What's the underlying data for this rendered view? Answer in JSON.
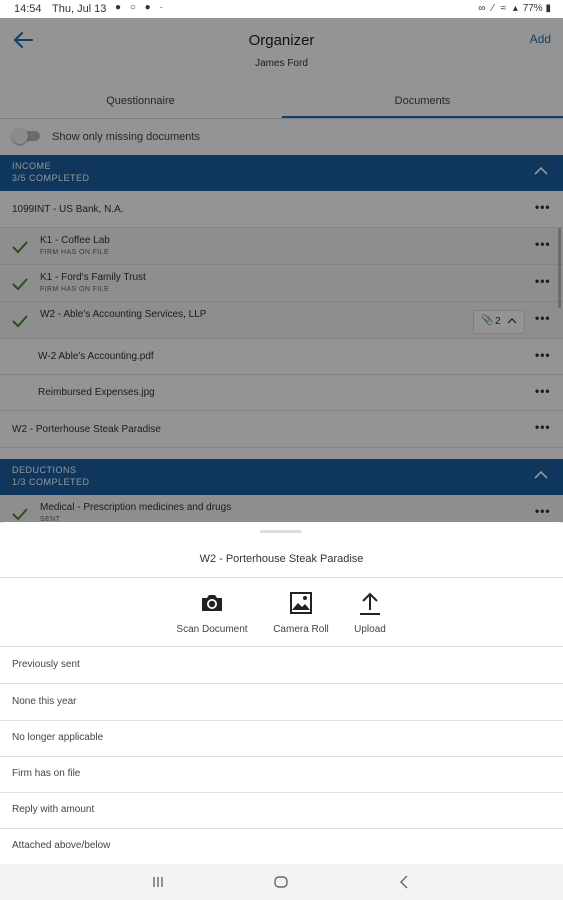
{
  "status_bar": {
    "time": "14:54",
    "date": "Thu, Jul 13",
    "battery": "77%"
  },
  "header": {
    "title": "Organizer",
    "subtitle": "James Ford",
    "add_label": "Add"
  },
  "tabs": [
    {
      "label": "Questionnaire",
      "active": false
    },
    {
      "label": "Documents",
      "active": true
    }
  ],
  "filter": {
    "toggle_label": "Show only missing documents",
    "enabled": false
  },
  "sections": [
    {
      "title": "INCOME",
      "progress": "3/5 COMPLETED",
      "items": [
        {
          "label": "1099INT - US Bank, N.A.",
          "checked": false
        },
        {
          "label": "K1 - Coffee Lab",
          "sublabel": "FIRM HAS ON FILE",
          "checked": true
        },
        {
          "label": "K1 - Ford's Family Trust",
          "sublabel": "FIRM HAS ON FILE",
          "checked": true
        },
        {
          "label": "W2 - Able's Accounting Services, LLP",
          "checked": true,
          "attachments": "2"
        },
        {
          "label": "W-2 Able's Accounting.pdf"
        },
        {
          "label": "Reimbursed Expenses.jpg"
        },
        {
          "label": "W2 - Porterhouse Steak Paradise",
          "checked": false
        }
      ]
    },
    {
      "title": "DEDUCTIONS",
      "progress": "1/3 COMPLETED",
      "items": [
        {
          "label": "Medical - Prescription medicines and drugs",
          "sublabel": "SENT",
          "checked": true
        }
      ]
    }
  ],
  "sheet": {
    "title": "W2 - Porterhouse Steak Paradise",
    "actions": [
      {
        "label": "Scan Document",
        "icon": "camera-icon"
      },
      {
        "label": "Camera Roll",
        "icon": "image-icon"
      },
      {
        "label": "Upload",
        "icon": "upload-icon"
      }
    ],
    "options": [
      "Previously sent",
      "None this year",
      "No longer applicable",
      "Firm has on file",
      "Reply with amount",
      "Attached above/below"
    ]
  },
  "colors": {
    "accent": "#1b5fa0",
    "link": "#1a6fb5",
    "check": "#4a8a2a"
  }
}
